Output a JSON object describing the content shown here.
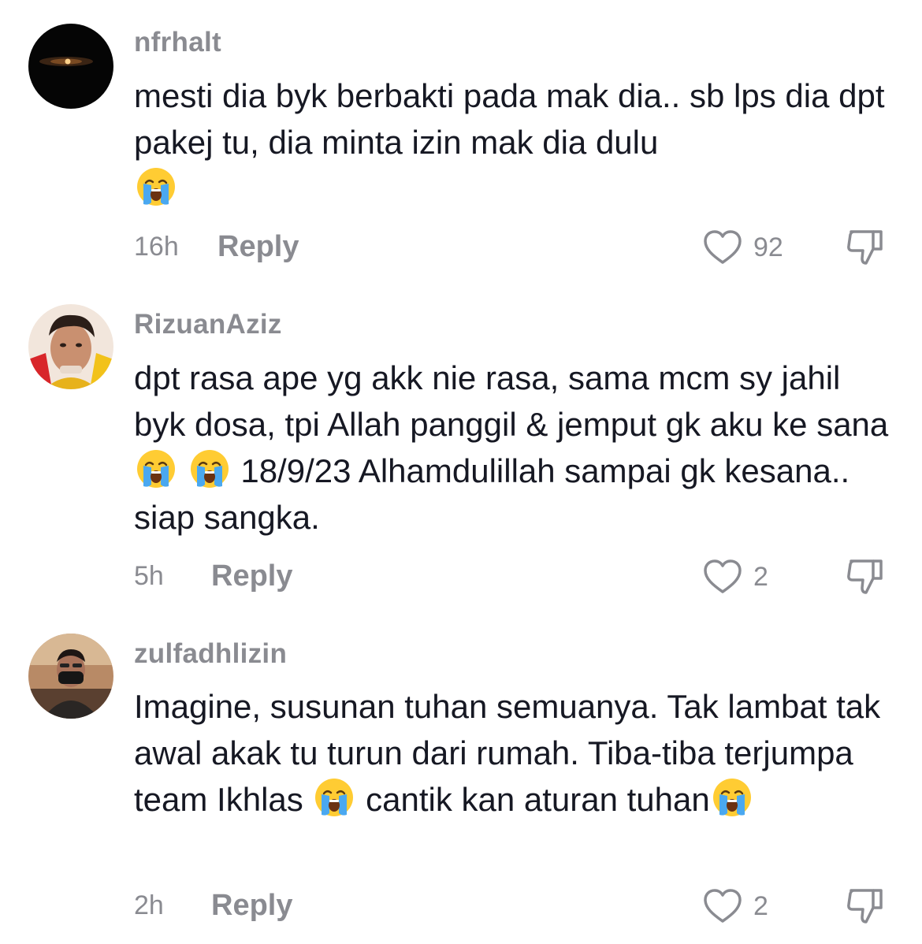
{
  "comments": [
    {
      "username": "nfrhalt",
      "avatar_icon": "night-sky-avatar",
      "text_parts": [
        "mesti dia byk berbakti pada mak dia.. sb lps dia dpt pakej tu, dia minta izin mak dia dulu"
      ],
      "emoji": "loudly-crying-face",
      "time": "16h",
      "reply_label": "Reply",
      "like_count": "92"
    },
    {
      "username": "RizuanAziz",
      "avatar_icon": "man-portrait-avatar",
      "text_parts": [
        "dpt rasa ape yg akk nie rasa, sama mcm sy jahil byk dosa, tpi Allah panggil & jemput gk aku ke sana",
        " 18/9/23 Alhamdulillah sampai gk kesana.. siap sangka."
      ],
      "emoji": "loudly-crying-face",
      "time": "5h",
      "reply_label": "Reply",
      "like_count": "2"
    },
    {
      "username": "zulfadhlizin",
      "avatar_icon": "masked-man-avatar",
      "text_parts": [
        "Imagine, susunan tuhan semuanya. Tak lambat tak awal akak tu turun dari rumah. Tiba-tiba terjumpa team Ikhlas",
        "cantik kan aturan tuhan"
      ],
      "emoji": "loudly-crying-face",
      "time": "2h",
      "reply_label": "Reply",
      "like_count": "2"
    }
  ],
  "icons": {
    "like": "heart-outline-icon",
    "dislike": "thumbs-down-outline-icon"
  },
  "colors": {
    "text": "#161823",
    "secondary": "#8a8b91",
    "background": "#ffffff"
  }
}
